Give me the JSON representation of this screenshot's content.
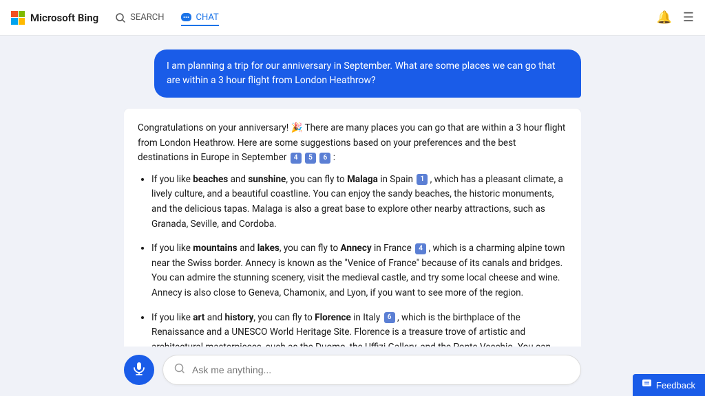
{
  "header": {
    "brand": "Microsoft Bing",
    "nav": [
      {
        "id": "search",
        "label": "SEARCH",
        "active": false
      },
      {
        "id": "chat",
        "label": "CHAT",
        "active": true
      }
    ]
  },
  "chat": {
    "user_message": "I am planning a trip for our anniversary in September. What are some places we can go that are within a 3 hour flight from London Heathrow?",
    "bot_intro": "Congratulations on your anniversary! 🎉 There are many places you can go that are within a 3 hour flight from London Heathrow. Here are some suggestions based on your preferences and the best destinations in Europe in September",
    "bot_intro_citations": [
      "4",
      "5",
      "6"
    ],
    "bot_items": [
      {
        "intro": "If you like ",
        "bold1": "beaches",
        "mid1": " and ",
        "bold2": "sunshine",
        "mid2": ", you can fly to ",
        "bold3": "Malaga",
        "mid3": " in Spain",
        "citation": "1",
        "rest": ", which has a pleasant climate, a lively culture, and a beautiful coastline. You can enjoy the sandy beaches, the historic monuments, and the delicious tapas. Malaga is also a great base to explore other nearby attractions, such as Granada, Seville, and Cordoba."
      },
      {
        "intro": "If you like ",
        "bold1": "mountains",
        "mid1": " and ",
        "bold2": "lakes",
        "mid2": ", you can fly to ",
        "bold3": "Annecy",
        "mid3": " in France",
        "citation": "4",
        "rest": ", which is a charming alpine town near the Swiss border. Annecy is known as the \"Venice of France\" because of its canals and bridges. You can admire the stunning scenery, visit the medieval castle, and try some local cheese and wine. Annecy is also close to Geneva, Chamonix, and Lyon, if you want to see more of the region."
      },
      {
        "intro": "If you like ",
        "bold1": "art",
        "mid1": " and ",
        "bold2": "history",
        "mid2": ", you can fly to ",
        "bold3": "Florence",
        "mid3": " in Italy",
        "citation": "6",
        "rest": ", which is the birthplace of the Renaissance and a UNESCO World Heritage Site. Florence is a treasure trove of artistic and architectural masterpieces, such as the Duomo, the Uffizi Gallery, and the Ponte Vecchio. You can also explore the Tuscan countryside, taste the famous gelato, and shop for leather goods."
      }
    ]
  },
  "input": {
    "placeholder": "Ask me anything..."
  },
  "feedback": {
    "label": "Feedback"
  }
}
